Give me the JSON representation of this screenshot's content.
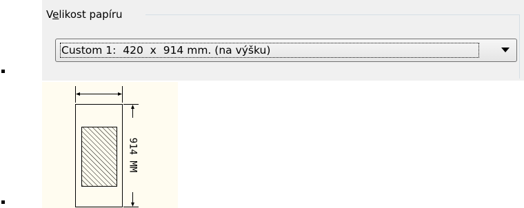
{
  "paper_size": {
    "group_title_prefix": "V",
    "group_title_mnemonic": "e",
    "group_title_suffix": "likost papíru",
    "selected_value": "Custom 1:  420  x  914 mm. (na výšku)"
  },
  "preview": {
    "height_label": "914  MM"
  },
  "colors": {
    "group_background": "#f0f0f0",
    "preview_background": "#fffcf0"
  },
  "icons": {
    "dropdown": "chevron-down-icon"
  }
}
